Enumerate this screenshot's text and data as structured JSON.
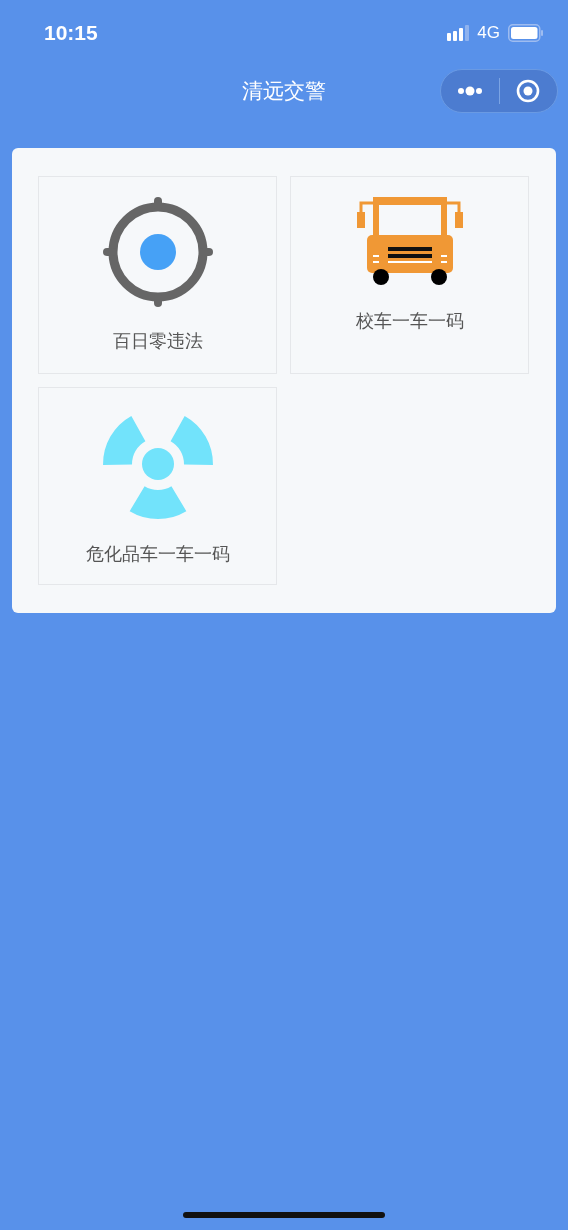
{
  "status_bar": {
    "time": "10:15",
    "network": "4G"
  },
  "nav_bar": {
    "title": "清远交警"
  },
  "tiles": [
    {
      "kind": "target",
      "label": "百日零违法"
    },
    {
      "kind": "bus",
      "label": "校车一车一码"
    },
    {
      "kind": "radiation",
      "label": "危化品车一车一码"
    }
  ]
}
